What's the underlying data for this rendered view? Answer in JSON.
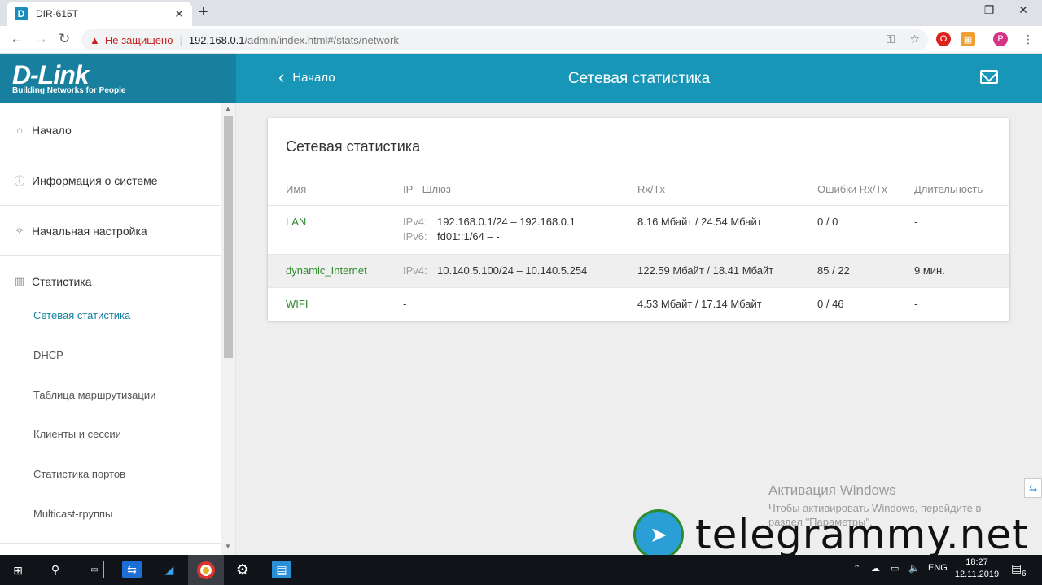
{
  "browser": {
    "tab_title": "DIR-615T",
    "favicon_letter": "D",
    "new_tab": "+",
    "security_label": "Не защищено",
    "url_host": "192.168.0.1",
    "url_path": "/admin/index.html#/stats/network",
    "profile_initial": "P"
  },
  "header": {
    "logo": "D-Link",
    "tagline": "Building Networks for People",
    "back_label": "Начало",
    "title": "Сетевая статистика"
  },
  "sidebar": {
    "items": [
      {
        "label": "Начало",
        "icon": "home-icon"
      },
      {
        "label": "Информация о системе",
        "icon": "info-icon"
      },
      {
        "label": "Начальная настройка",
        "icon": "wizard-icon"
      },
      {
        "label": "Статистика",
        "icon": "bar-chart-icon"
      }
    ],
    "subitems": [
      {
        "label": "Сетевая статистика",
        "active": true
      },
      {
        "label": "DHCP"
      },
      {
        "label": "Таблица маршрутизации"
      },
      {
        "label": "Клиенты и сессии"
      },
      {
        "label": "Статистика портов"
      },
      {
        "label": "Multicast-группы"
      }
    ]
  },
  "card": {
    "title": "Сетевая статистика",
    "columns": [
      "Имя",
      "IP - Шлюз",
      "Rx/Tx",
      "Ошибки Rx/Tx",
      "Длительность"
    ],
    "rows": [
      {
        "name": "LAN",
        "ip_label_1": "IPv4:",
        "ip_1": "192.168.0.1/24 – 192.168.0.1",
        "ip_label_2": "IPv6:",
        "ip_2": "fd01::1/64 –  -",
        "rxtx": "8.16 Мбайт / 24.54 Мбайт",
        "errors": "0 / 0",
        "duration": "-"
      },
      {
        "name": "dynamic_Internet",
        "ip_label_1": "IPv4:",
        "ip_1": "10.140.5.100/24 – 10.140.5.254",
        "rxtx": "122.59 Мбайт / 18.41 Мбайт",
        "errors": "85 / 22",
        "duration": "9 мин."
      },
      {
        "name": "WIFI",
        "ip": "-",
        "rxtx": "4.53 Мбайт / 17.14 Мбайт",
        "errors": "0 / 46",
        "duration": "-"
      }
    ]
  },
  "overlay": {
    "activation_title": "Активация Windows",
    "activation_sub_1": "Чтобы активировать Windows, перейдите в",
    "activation_sub_2": "раздел \"Параметры\".",
    "watermark": "telegrammy.net"
  },
  "taskbar": {
    "language": "ENG",
    "time": "18:27",
    "date": "12.11.2019",
    "notifications": "6"
  },
  "colors": {
    "brand_dark": "#18809e",
    "brand": "#1896b8",
    "link_green": "#2e8b2e"
  }
}
